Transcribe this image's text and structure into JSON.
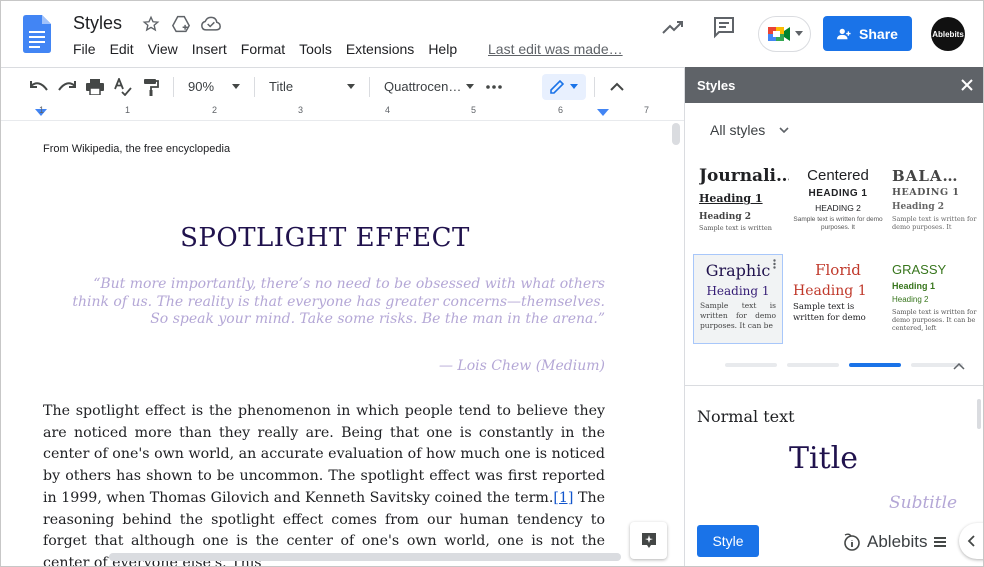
{
  "app": {
    "doc_title": "Styles",
    "menu": [
      "File",
      "Edit",
      "View",
      "Insert",
      "Format",
      "Tools",
      "Extensions",
      "Help"
    ],
    "last_edit": "Last edit was made…",
    "share_label": "Share",
    "avatar_text": "Ablebits"
  },
  "toolbar": {
    "zoom": "90%",
    "style": "Title",
    "font": "Quattrocen…"
  },
  "ruler": {
    "ticks": [
      "1",
      "1",
      "2",
      "3",
      "4",
      "5",
      "6",
      "7"
    ]
  },
  "document": {
    "wiki_note": "From Wikipedia, the free encyclopedia",
    "heading": "SPOTLIGHT EFFECT",
    "quote": "“But more importantly, there’s no need to be obsessed with what others think of us. The reality is that everyone has greater concerns—themselves. So speak your mind. Take some risks. Be the man in the arena.”",
    "quote_author": "— Lois Chew (Medium)",
    "body_part1": "The spotlight effect is the phenomenon in which people tend to believe they are noticed more than they really are. Being that one is constantly in the center of one's own world, an accurate evaluation of how much one is noticed by others has shown to be uncommon. The spotlight effect was first reported in 1999, when Thomas Gilovich and Kenneth Savitsky coined the term.",
    "body_ref": "[1]",
    "body_part2": " The reasoning behind the spotlight effect comes from our human tendency to forget that although one is the center of one's own world, one is not the center of everyone else's. This"
  },
  "panel": {
    "title": "Styles",
    "filter": "All styles",
    "cards": [
      {
        "l1": "Journali…",
        "l2": "Heading 1",
        "l3": "Heading 2",
        "l4": "Sample text is written"
      },
      {
        "l1": "Centered",
        "l2": "HEADING 1",
        "l3": "HEADING 2",
        "l4": "Sample text is written for demo purposes. It"
      },
      {
        "l1": "BALA…",
        "l2": "HEADING 1",
        "l3": "Heading 2",
        "l4": "Sample text is written for demo purposes. It"
      },
      {
        "l1": "Graphic",
        "l2": "Heading 1",
        "l3": "Sample text is written for demo purposes. It can be"
      },
      {
        "l1": "Florid",
        "l2": "Heading 1",
        "l3": "Sample text is written for demo"
      },
      {
        "l1": "GRASSY",
        "l2": "Heading 1",
        "l3": "Heading 2",
        "l4": "Sample text is written for demo purposes. It can be centered, left"
      }
    ],
    "preview": {
      "normal": "Normal text",
      "title": "Title",
      "subtitle": "Subtitle"
    },
    "style_button": "Style",
    "brand": "Ablebits"
  },
  "colors": {
    "accent": "#1a73e8",
    "title_color": "#20124d",
    "quote_color": "#b4a7d6",
    "panel_header": "#5f6368"
  }
}
